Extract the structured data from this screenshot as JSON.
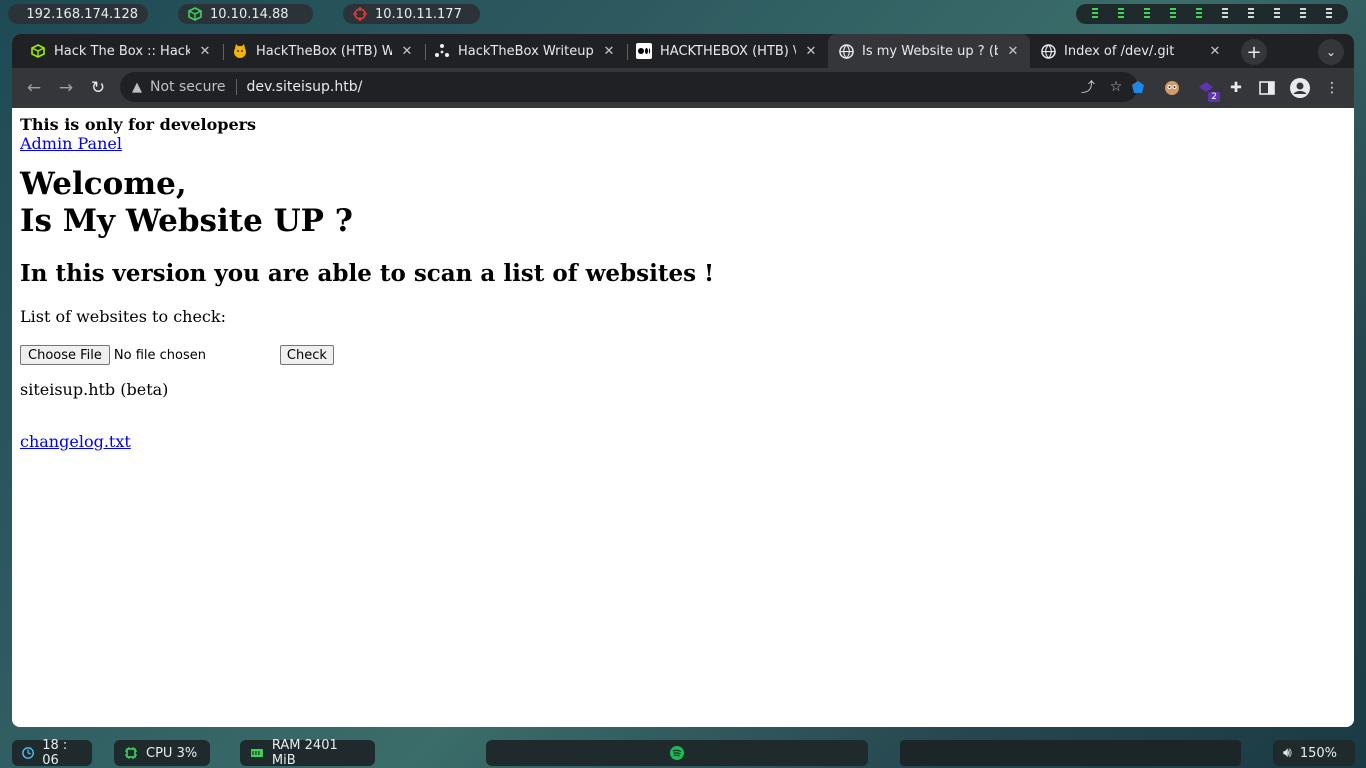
{
  "topbar": {
    "host_ip": "192.168.174.128",
    "vpn_ip": "10.10.14.88",
    "target_ip": "10.10.11.177"
  },
  "tabs": [
    {
      "title": "Hack The Box :: Hack",
      "icon": "htb-cube-icon"
    },
    {
      "title": "HackTheBox (HTB) W",
      "icon": "cat-face-icon"
    },
    {
      "title": "HackTheBox Writeup",
      "icon": "dots-logo-icon"
    },
    {
      "title": "HACKTHEBOX (HTB) \\",
      "icon": "medium-logo-icon"
    },
    {
      "title": "Is my Website up ? (b",
      "icon": "globe-icon",
      "active": true
    },
    {
      "title": "Index of /dev/.git",
      "icon": "globe-icon"
    }
  ],
  "address_bar": {
    "security_label": "Not secure",
    "url": "dev.siteisup.htb/"
  },
  "extensions": {
    "badge_count": "2"
  },
  "page": {
    "dev_notice": "This is only for developers",
    "admin_link": "Admin Panel",
    "welcome_line1": "Welcome,",
    "welcome_line2": "Is My Website UP ?",
    "subtitle": "In this version you are able to scan a list of websites !",
    "list_label": "List of websites to check:",
    "choose_file_label": "Choose File",
    "no_file_label": "No file chosen",
    "check_label": "Check",
    "beta_note": "siteisup.htb (beta)",
    "changelog_link": "changelog.txt"
  },
  "statusbar": {
    "clock": "18 : 06",
    "cpu": "CPU 3%",
    "ram": "RAM 2401 MiB",
    "volume": "150%"
  },
  "colors": {
    "accent_green": "#3fd45a",
    "target_red": "#e53935",
    "link_blue": "#0000ee",
    "chrome_dark": "#202124"
  }
}
